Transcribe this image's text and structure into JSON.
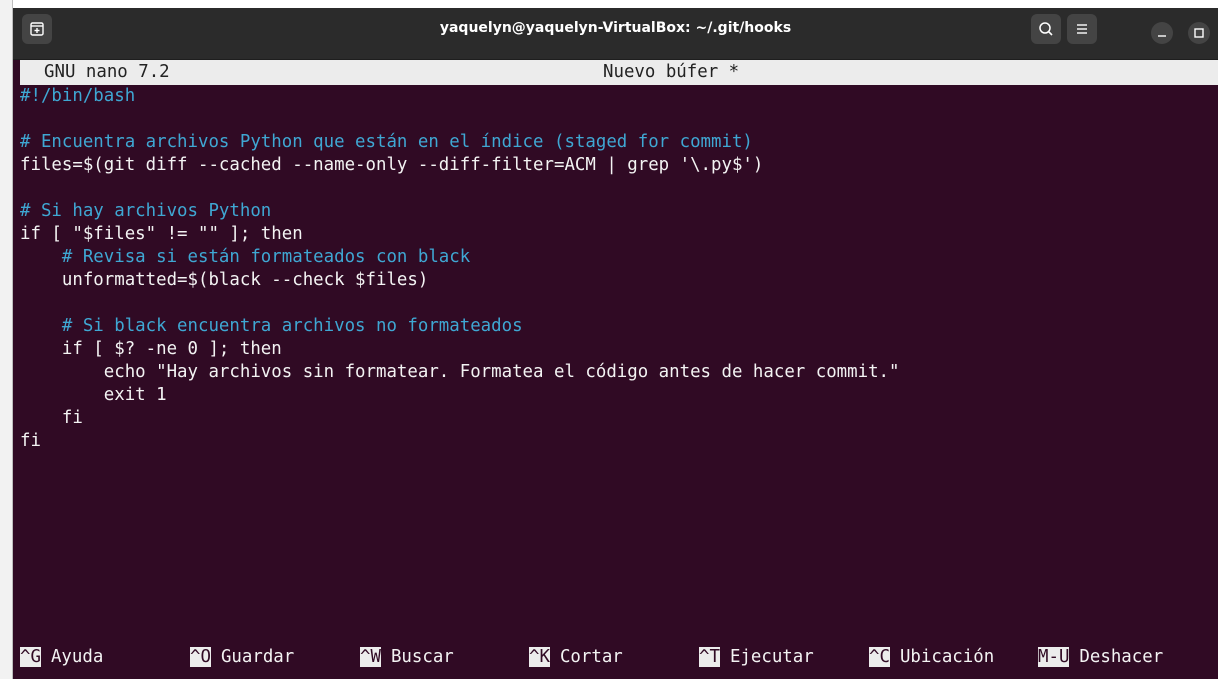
{
  "window": {
    "title": "yaquelyn@yaquelyn-VirtualBox: ~/.git/hooks"
  },
  "titlebar_icons": {
    "new_tab": "new-tab-icon",
    "search": "search-icon",
    "menu": "hamburger-menu-icon",
    "minimize": "minimize-icon",
    "maximize": "maximize-icon"
  },
  "nano": {
    "version": "GNU nano 7.2",
    "buffer": "Nuevo búfer *"
  },
  "editor": {
    "lines": [
      {
        "text": "#!/bin/bash",
        "kind": "shebang"
      },
      {
        "text": "",
        "kind": "code"
      },
      {
        "text": "# Encuentra archivos Python que están en el índice (staged for commit)",
        "kind": "comment"
      },
      {
        "text": "files=$(git diff --cached --name-only --diff-filter=ACM | grep '\\.py$')",
        "kind": "code"
      },
      {
        "text": "",
        "kind": "code"
      },
      {
        "text": "# Si hay archivos Python",
        "kind": "comment"
      },
      {
        "text": "if [ \"$files\" != \"\" ]; then",
        "kind": "code"
      },
      {
        "text": "    # Revisa si están formateados con black",
        "kind": "comment"
      },
      {
        "text": "    unformatted=$(black --check $files)",
        "kind": "code"
      },
      {
        "text": "",
        "kind": "code"
      },
      {
        "text": "    # Si black encuentra archivos no formateados",
        "kind": "comment"
      },
      {
        "text": "    if [ $? -ne 0 ]; then",
        "kind": "code"
      },
      {
        "text": "        echo \"Hay archivos sin formatear. Formatea el código antes de hacer commit.\"",
        "kind": "code"
      },
      {
        "text": "        exit 1",
        "kind": "code"
      },
      {
        "text": "    fi",
        "kind": "code"
      },
      {
        "text": "fi",
        "kind": "code"
      }
    ]
  },
  "shortcuts": {
    "row1": [
      {
        "key": "^G",
        "label": "Ayuda"
      },
      {
        "key": "^O",
        "label": "Guardar"
      },
      {
        "key": "^W",
        "label": "Buscar"
      },
      {
        "key": "^K",
        "label": "Cortar"
      },
      {
        "key": "^T",
        "label": "Ejecutar"
      },
      {
        "key": "^C",
        "label": "Ubicación"
      },
      {
        "key": "M-U",
        "label": "Deshacer"
      }
    ]
  },
  "colors": {
    "terminal_bg": "#300a24",
    "titlebar_bg": "#2b2b2b",
    "comment": "#3fa7d3",
    "text": "#f3f3f3",
    "header_bg": "#ececec"
  }
}
